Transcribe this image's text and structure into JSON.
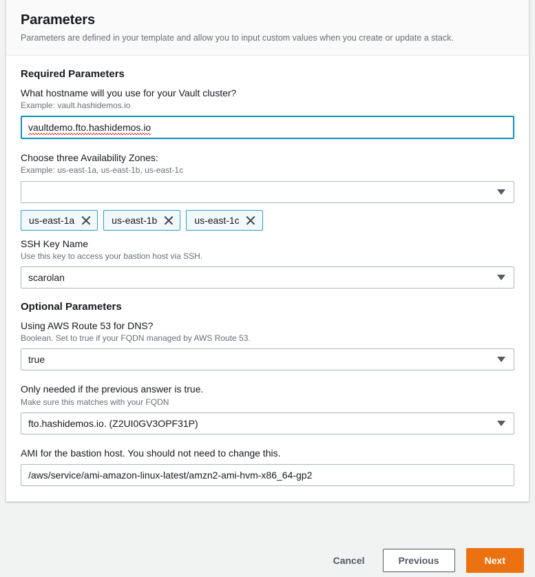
{
  "header": {
    "title": "Parameters",
    "subtitle": "Parameters are defined in your template and allow you to input custom values when you create or update a stack."
  },
  "sections": {
    "required": {
      "title": "Required Parameters",
      "hostname": {
        "label": "What hostname will you use for your Vault cluster?",
        "description": "Example: vault.hashidemos.io",
        "value": "vaultdemo.fto.hashidemos.io",
        "focused": true,
        "spellcheck_error": true
      },
      "availability_zones": {
        "label": "Choose three Availability Zones:",
        "description": "Example: us-east-1a, us-east-1b, us-east-1c",
        "selected_value": "",
        "caret": "chevron-down-icon",
        "tokens": [
          {
            "label": "us-east-1a",
            "remove": "close-icon"
          },
          {
            "label": "us-east-1b",
            "remove": "close-icon"
          },
          {
            "label": "us-east-1c",
            "remove": "close-icon"
          }
        ]
      },
      "ssh_key": {
        "label": "SSH Key Name",
        "description": "Use this key to access your bastion host via SSH.",
        "value": "scarolan",
        "caret": "chevron-down-icon"
      }
    },
    "optional": {
      "title": "Optional Parameters",
      "route53": {
        "label": "Using AWS Route 53 for DNS?",
        "description": "Boolean. Set to true if your FQDN managed by AWS Route 53.",
        "value": "true",
        "caret": "chevron-down-icon"
      },
      "hosted_zone": {
        "label": "Only needed if the previous answer is true.",
        "description": "Make sure this matches with your FQDN",
        "value": "fto.hashidemos.io. (Z2UI0GV3OPF31P)",
        "caret": "chevron-down-icon"
      },
      "ami": {
        "label": "AMI for the bastion host. You should not need to change this.",
        "description": "",
        "value": "/aws/service/ami-amazon-linux-latest/amzn2-ami-hvm-x86_64-gp2"
      }
    }
  },
  "footer": {
    "cancel_label": "Cancel",
    "previous_label": "Previous",
    "next_label": "Next"
  },
  "colors": {
    "primary_button": "#ec7211",
    "focus_border": "#0a8ebf",
    "token_border": "#2a9fc4",
    "token_background": "#f1f9fd",
    "page_background": "#f1f3f3",
    "label_text": "#16191f",
    "description_text": "#687078",
    "spellcheck_underline": "#e03131"
  }
}
